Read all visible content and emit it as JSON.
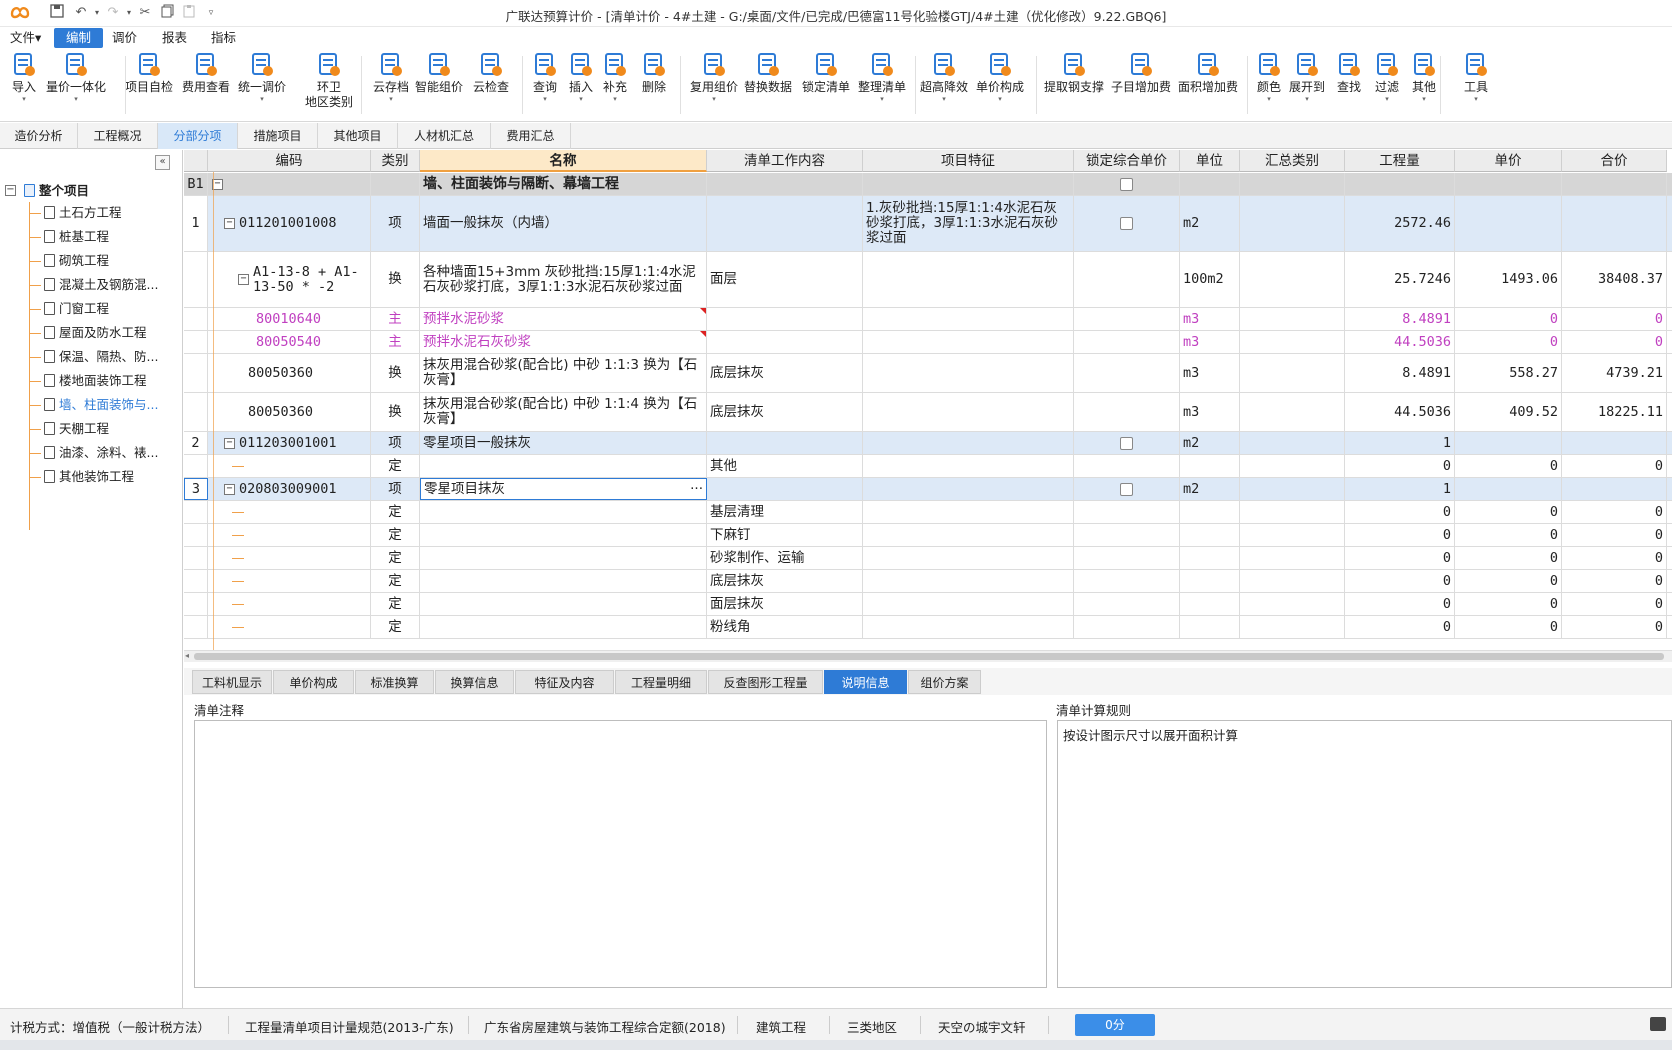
{
  "app": {
    "title": "广联达预算计价 - [清单计价 - 4#土建 - G:/桌面/文件/已完成/巴德富11号化验楼GTJ/4#土建（优化修改）9.22.GBQ6]",
    "brand_color": "#f08a1c"
  },
  "menubar": {
    "items": [
      "文件▾",
      "编制",
      "调价",
      "报表",
      "指标"
    ],
    "active": "编制"
  },
  "ribbon": {
    "buttons": [
      {
        "label": "导入",
        "dropdown": true,
        "icon": "import-icon"
      },
      {
        "label": "量价一体化",
        "dropdown": true,
        "icon": "integration-icon"
      },
      {
        "label": "项目自检",
        "dropdown": false,
        "icon": "self-check-icon"
      },
      {
        "label": "费用查看",
        "dropdown": false,
        "icon": "fee-view-icon"
      },
      {
        "label": "统一调价",
        "dropdown": true,
        "icon": "price-adjust-icon"
      },
      {
        "label": "环卫\n地区类别",
        "dropdown": false,
        "icon": "sanitation-icon"
      },
      {
        "label": "云存档",
        "dropdown": true,
        "icon": "cloud-archive-icon"
      },
      {
        "label": "智能组价",
        "dropdown": false,
        "icon": "smart-price-icon"
      },
      {
        "label": "云检查",
        "dropdown": false,
        "icon": "cloud-check-icon"
      },
      {
        "label": "查询",
        "dropdown": true,
        "icon": "query-icon"
      },
      {
        "label": "插入",
        "dropdown": true,
        "icon": "insert-icon"
      },
      {
        "label": "补充",
        "dropdown": true,
        "icon": "supplement-icon"
      },
      {
        "label": "删除",
        "dropdown": false,
        "icon": "delete-icon"
      },
      {
        "label": "复用组价",
        "dropdown": true,
        "icon": "reuse-price-icon"
      },
      {
        "label": "替换数据",
        "dropdown": false,
        "icon": "replace-data-icon"
      },
      {
        "label": "锁定清单",
        "dropdown": false,
        "icon": "lock-list-icon"
      },
      {
        "label": "整理清单",
        "dropdown": true,
        "icon": "organize-list-icon"
      },
      {
        "label": "超高降效",
        "dropdown": true,
        "icon": "height-efficiency-icon"
      },
      {
        "label": "单价构成",
        "dropdown": true,
        "icon": "unit-price-icon"
      },
      {
        "label": "提取钢支撑",
        "dropdown": false,
        "icon": "steel-support-icon"
      },
      {
        "label": "子目增加费",
        "dropdown": false,
        "icon": "sub-item-fee-icon"
      },
      {
        "label": "面积增加费",
        "dropdown": false,
        "icon": "area-fee-icon"
      },
      {
        "label": "颜色",
        "dropdown": true,
        "icon": "color-icon"
      },
      {
        "label": "展开到",
        "dropdown": true,
        "icon": "expand-to-icon"
      },
      {
        "label": "查找",
        "dropdown": false,
        "icon": "find-icon"
      },
      {
        "label": "过滤",
        "dropdown": true,
        "icon": "filter-icon"
      },
      {
        "label": "其他",
        "dropdown": true,
        "icon": "other-icon"
      },
      {
        "label": "工具",
        "dropdown": true,
        "icon": "tools-icon"
      }
    ]
  },
  "navtabs": {
    "items": [
      "造价分析",
      "工程概况",
      "分部分项",
      "措施项目",
      "其他项目",
      "人材机汇总",
      "费用汇总"
    ],
    "active": "分部分项"
  },
  "sidebar": {
    "collapse_label": "«",
    "root": "整个项目",
    "items": [
      "土石方工程",
      "桩基工程",
      "砌筑工程",
      "混凝土及钢筋混...",
      "门窗工程",
      "屋面及防水工程",
      "保温、隔热、防...",
      "楼地面装饰工程",
      "墙、柱面装饰与...",
      "天棚工程",
      "油漆、涂料、裱...",
      "其他装饰工程"
    ],
    "selected": "墙、柱面装饰与..."
  },
  "grid": {
    "headers": [
      "编码",
      "类别",
      "名称",
      "清单工作内容",
      "项目特征",
      "锁定综合单价",
      "单位",
      "汇总类别",
      "工程量",
      "单价",
      "合价"
    ],
    "rows": [
      {
        "no": "B1",
        "code": "",
        "type": "",
        "name": "墙、柱面装饰与隔断、幕墙工程",
        "work": "",
        "feature": "",
        "unit": "",
        "qty": "",
        "price": "",
        "total": "",
        "kind": "section",
        "lock": true
      },
      {
        "no": "1",
        "code": "011201001008",
        "type": "项",
        "name": "墙面一般抹灰（内墙）",
        "work": "",
        "feature": "1.灰砂批挡:15厚1:1:4水泥石灰砂浆打底，3厚1:1:3水泥石灰砂浆过面",
        "unit": "m2",
        "qty": "2572.46",
        "price": "",
        "total": "",
        "kind": "item",
        "lock": true
      },
      {
        "no": "",
        "code": "A1-13-8 + A1-13-50 * -2",
        "type": "换",
        "name": "各种墙面15+3mm 灰砂批挡:15厚1:1:4水泥石灰砂浆打底，3厚1:1:3水泥石灰砂浆过面",
        "work": "面层",
        "feature": "",
        "unit": "100m2",
        "qty": "25.7246",
        "price": "1493.06",
        "total": "38408.37",
        "kind": "quota"
      },
      {
        "no": "",
        "code": "80010640",
        "type": "主",
        "name": "预拌水泥砂浆",
        "work": "",
        "feature": "",
        "unit": "m3",
        "qty": "8.4891",
        "price": "0",
        "total": "0",
        "kind": "material"
      },
      {
        "no": "",
        "code": "80050540",
        "type": "主",
        "name": "预拌水泥石灰砂浆",
        "work": "",
        "feature": "",
        "unit": "m3",
        "qty": "44.5036",
        "price": "0",
        "total": "0",
        "kind": "material"
      },
      {
        "no": "",
        "code": "80050360",
        "type": "换",
        "name": "抹灰用混合砂浆(配合比) 中砂 1:1:3 换为【石灰膏】",
        "work": "底层抹灰",
        "feature": "",
        "unit": "m3",
        "qty": "8.4891",
        "price": "558.27",
        "total": "4739.21",
        "kind": "quota2"
      },
      {
        "no": "",
        "code": "80050360",
        "type": "换",
        "name": "抹灰用混合砂浆(配合比) 中砂 1:1:4 换为【石灰膏】",
        "work": "底层抹灰",
        "feature": "",
        "unit": "m3",
        "qty": "44.5036",
        "price": "409.52",
        "total": "18225.11",
        "kind": "quota2"
      },
      {
        "no": "2",
        "code": "011203001001",
        "type": "项",
        "name": "零星项目一般抹灰",
        "work": "",
        "feature": "",
        "unit": "m2",
        "qty": "1",
        "price": "",
        "total": "",
        "kind": "item",
        "lock": true
      },
      {
        "no": "",
        "code": "",
        "type": "定",
        "name": "",
        "work": "其他",
        "feature": "",
        "unit": "",
        "qty": "0",
        "price": "0",
        "total": "0",
        "kind": "def"
      },
      {
        "no": "3",
        "code": "020803009001",
        "type": "项",
        "name": "零星项目抹灰",
        "work": "",
        "feature": "",
        "unit": "m2",
        "qty": "1",
        "price": "",
        "total": "",
        "kind": "item-active",
        "lock": true,
        "ellipsis": "···"
      },
      {
        "no": "",
        "code": "",
        "type": "定",
        "name": "",
        "work": "基层清理",
        "feature": "",
        "unit": "",
        "qty": "0",
        "price": "0",
        "total": "0",
        "kind": "def"
      },
      {
        "no": "",
        "code": "",
        "type": "定",
        "name": "",
        "work": "下麻钉",
        "feature": "",
        "unit": "",
        "qty": "0",
        "price": "0",
        "total": "0",
        "kind": "def"
      },
      {
        "no": "",
        "code": "",
        "type": "定",
        "name": "",
        "work": "砂浆制作、运输",
        "feature": "",
        "unit": "",
        "qty": "0",
        "price": "0",
        "total": "0",
        "kind": "def"
      },
      {
        "no": "",
        "code": "",
        "type": "定",
        "name": "",
        "work": "底层抹灰",
        "feature": "",
        "unit": "",
        "qty": "0",
        "price": "0",
        "total": "0",
        "kind": "def"
      },
      {
        "no": "",
        "code": "",
        "type": "定",
        "name": "",
        "work": "面层抹灰",
        "feature": "",
        "unit": "",
        "qty": "0",
        "price": "0",
        "total": "0",
        "kind": "def"
      },
      {
        "no": "",
        "code": "",
        "type": "定",
        "name": "",
        "work": "粉线角",
        "feature": "",
        "unit": "",
        "qty": "0",
        "price": "0",
        "total": "0",
        "kind": "def"
      }
    ]
  },
  "bottom_tabs": {
    "items": [
      "工料机显示",
      "单价构成",
      "标准换算",
      "换算信息",
      "特征及内容",
      "工程量明细",
      "反查图形工程量",
      "说明信息",
      "组价方案"
    ],
    "active": "说明信息"
  },
  "panels": {
    "left_label": "清单注释",
    "left_text": "",
    "right_label": "清单计算规则",
    "right_text": "按设计图示尺寸以展开面积计算"
  },
  "statusbar": {
    "items": [
      "计税方式：增值税（一般计税方法）",
      "工程量清单项目计量规范(2013-广东)",
      "广东省房屋建筑与装饰工程综合定额(2018)",
      "建筑工程",
      "三类地区",
      "天空の城宇文轩"
    ],
    "score_button": "0分"
  },
  "colors": {
    "accent": "#2e7bd6",
    "selected_row": "#dde9f7",
    "section_row": "#d6d6d6",
    "material_text": "#c040c0",
    "tree_line": "#f0a04a"
  }
}
